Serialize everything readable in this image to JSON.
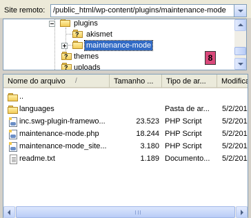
{
  "remote_site": {
    "label": "Site remoto:",
    "path": "/public_html/wp-content/plugins/maintenance-mode"
  },
  "tree": {
    "items": [
      {
        "label": "plugins",
        "icon": "folder-icon",
        "expanded": true
      },
      {
        "label": "akismet",
        "icon": "folder-question-icon"
      },
      {
        "label": "maintenance-mode",
        "icon": "folder-open-icon",
        "selected": true
      },
      {
        "label": "themes",
        "icon": "folder-question-icon"
      },
      {
        "label": "uploads",
        "icon": "folder-question-icon"
      }
    ],
    "badge": "8"
  },
  "file_list": {
    "columns": [
      "Nome do arquivo",
      "Tamanho ...",
      "Tipo de ar...",
      "Modifica"
    ],
    "sort_indicator": "/",
    "rows": [
      {
        "name": "..",
        "size": "",
        "type": "",
        "modified": "",
        "icon": "folder-up-icon"
      },
      {
        "name": "languages",
        "size": "",
        "type": "Pasta de ar...",
        "modified": "5/2/201",
        "icon": "folder-icon"
      },
      {
        "name": "inc.swg-plugin-framewo...",
        "size": "23.523",
        "type": "PHP Script",
        "modified": "5/2/201",
        "icon": "php-file-icon"
      },
      {
        "name": "maintenance-mode.php",
        "size": "18.244",
        "type": "PHP Script",
        "modified": "5/2/201",
        "icon": "php-file-icon"
      },
      {
        "name": "maintenance-mode_site...",
        "size": "3.180",
        "type": "PHP Script",
        "modified": "5/2/201",
        "icon": "php-file-icon"
      },
      {
        "name": "readme.txt",
        "size": "1.189",
        "type": "Documento...",
        "modified": "5/2/201",
        "icon": "text-file-icon"
      }
    ]
  },
  "colors": {
    "selection": "#316ac5",
    "badge": "#d9487a",
    "border": "#7f9db9"
  }
}
